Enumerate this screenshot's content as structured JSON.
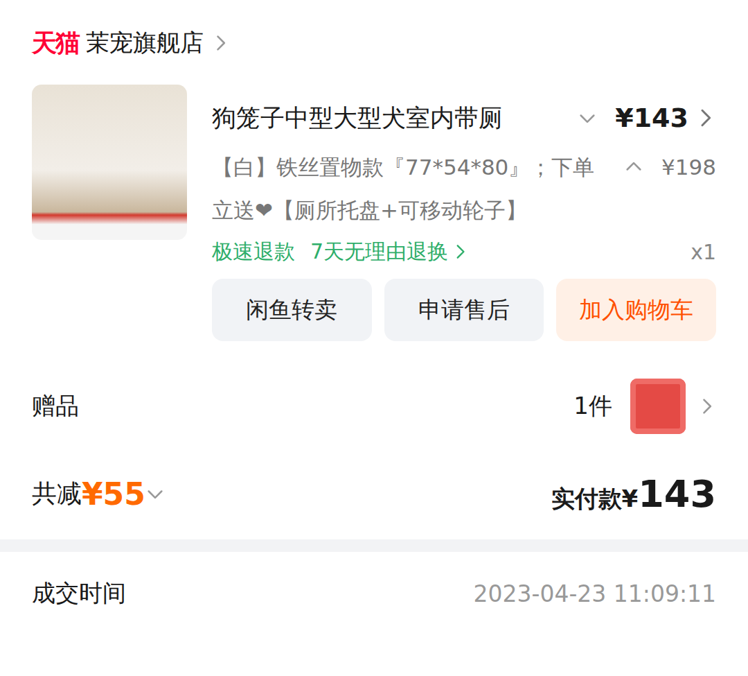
{
  "store": {
    "logo": "天猫",
    "name": "茉宠旗舰店"
  },
  "product": {
    "title": "狗笼子中型大型犬室内带厕",
    "price": "¥143",
    "spec": "【白】铁丝置物款『77*54*80』；下单立送❤【厕所托盘+可移动轮子】",
    "original_price": "¥198",
    "services": [
      "极速退款",
      "7天无理由退换"
    ],
    "quantity": "x1"
  },
  "actions": [
    {
      "label": "闲鱼转卖",
      "primary": false
    },
    {
      "label": "申请售后",
      "primary": false
    },
    {
      "label": "加入购物车",
      "primary": true
    }
  ],
  "gift": {
    "label": "赠品",
    "count": "1件"
  },
  "summary": {
    "discount_label": "共减",
    "discount": "¥55",
    "paid_label": "实付款",
    "paid_currency": "¥",
    "paid_amount": "143"
  },
  "deal_time": {
    "label": "成交时间",
    "value": "2023-04-23 11:09:11"
  }
}
